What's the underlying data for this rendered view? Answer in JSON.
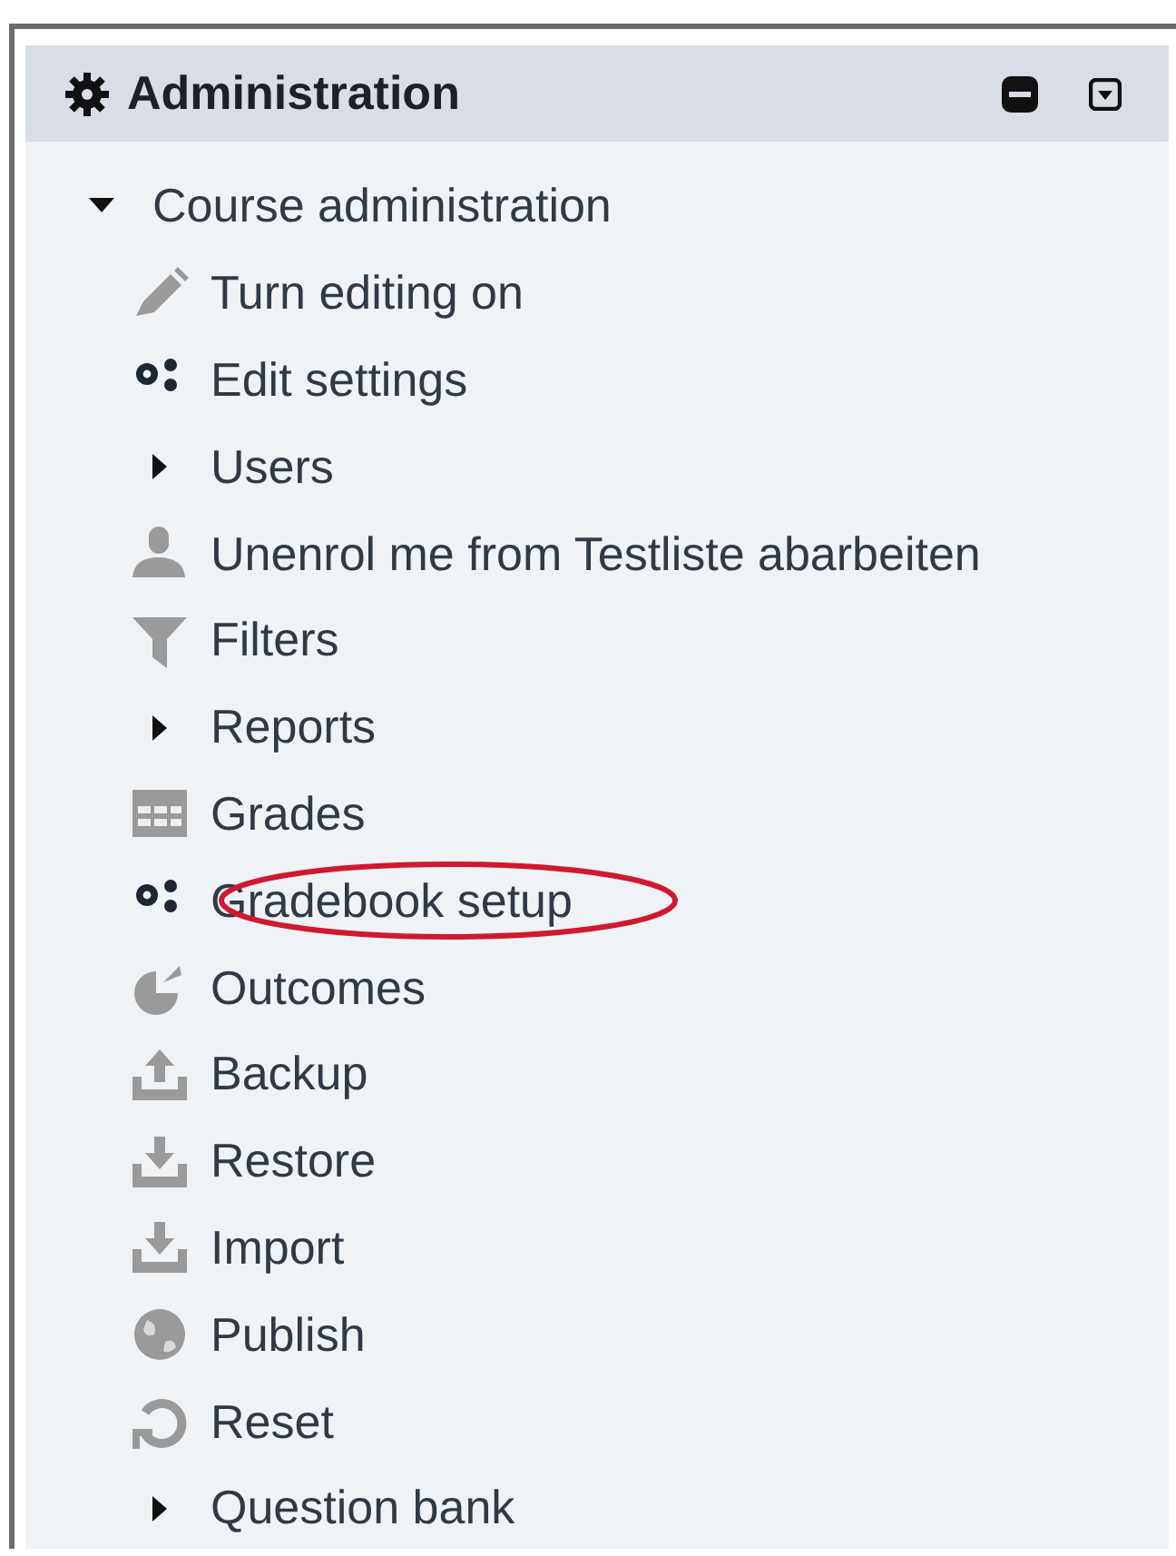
{
  "block": {
    "title": "Administration",
    "tree": [
      {
        "label": "Course administration",
        "kind": "branch",
        "expanded": true,
        "children": [
          {
            "label": "Turn editing on",
            "kind": "link",
            "highlighted": false
          },
          {
            "label": "Edit settings",
            "kind": "link",
            "highlighted": false
          },
          {
            "label": "Users",
            "kind": "branch",
            "expanded": false
          },
          {
            "label": "Unenrol me from Testliste abarbeiten",
            "kind": "link",
            "highlighted": false
          },
          {
            "label": "Filters",
            "kind": "link",
            "highlighted": false
          },
          {
            "label": "Reports",
            "kind": "branch",
            "expanded": false
          },
          {
            "label": "Grades",
            "kind": "link",
            "highlighted": false
          },
          {
            "label": "Gradebook setup",
            "kind": "link",
            "highlighted": true
          },
          {
            "label": "Outcomes",
            "kind": "link",
            "highlighted": false
          },
          {
            "label": "Backup",
            "kind": "link",
            "highlighted": false
          },
          {
            "label": "Restore",
            "kind": "link",
            "highlighted": false
          },
          {
            "label": "Import",
            "kind": "link",
            "highlighted": false
          },
          {
            "label": "Publish",
            "kind": "link",
            "highlighted": false
          },
          {
            "label": "Reset",
            "kind": "link",
            "highlighted": false
          },
          {
            "label": "Question bank",
            "kind": "branch",
            "expanded": false
          }
        ]
      }
    ]
  }
}
